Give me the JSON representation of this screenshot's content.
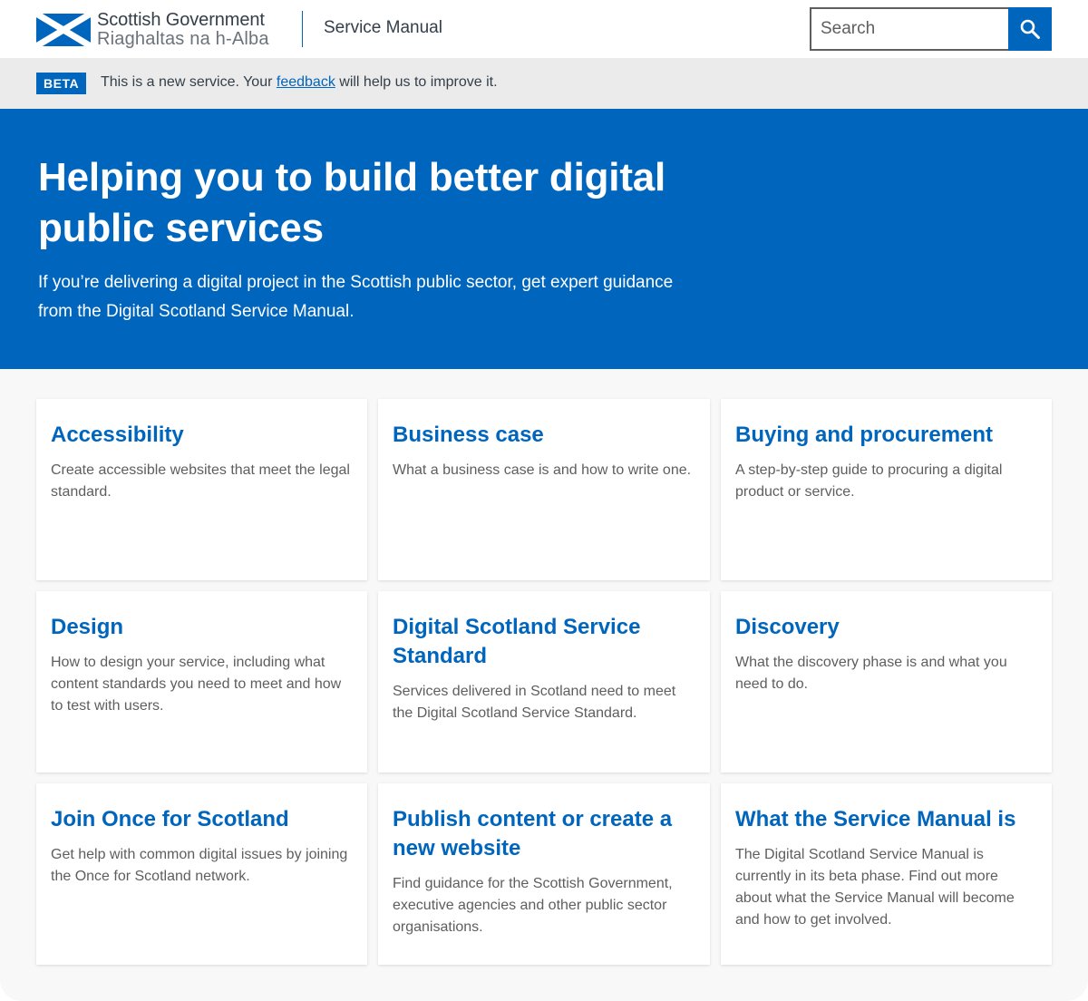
{
  "header": {
    "logo_en": "Scottish Government",
    "logo_gd": "Riaghaltas na h-Alba",
    "site_title": "Service Manual",
    "search_placeholder": "Search"
  },
  "phase_banner": {
    "tag": "BETA",
    "text_before": "This is a new service. Your ",
    "link": "feedback",
    "text_after": " will help us to improve it."
  },
  "hero": {
    "title": "Helping you to build better digital public services",
    "lead": "If you’re delivering a digital project in the Scottish public sector, get expert guidance from the Digital Scotland Service Manual."
  },
  "cards": [
    {
      "title": "Accessibility",
      "description": "Create accessible websites that meet the legal standard."
    },
    {
      "title": "Business case",
      "description": "What a business case is and how to write one."
    },
    {
      "title": "Buying and procurement",
      "description": "A step-by-step guide to procuring a digital product or service."
    },
    {
      "title": "Design",
      "description": "How to design your service, including what content standards you need to meet and how to test with users."
    },
    {
      "title": "Digital Scotland Service Standard",
      "description": "Services delivered in Scotland need to meet the Digital Scotland Service Standard."
    },
    {
      "title": "Discovery",
      "description": "What the discovery phase is and what you need to do."
    },
    {
      "title": "Join Once for Scotland",
      "description": "Get help with common digital issues by joining the Once for Scotland network."
    },
    {
      "title": "Publish content or create a new website",
      "description": "Find guidance for the Scottish Government, executive agencies and other public sector organisations."
    },
    {
      "title": "What the Service Manual is",
      "description": "The Digital Scotland Service Manual is currently in its beta phase. Find out more about what the Service Manual will become and how to get involved."
    }
  ],
  "colors": {
    "brand_blue": "#0065bd",
    "text": "#333e48",
    "muted_text": "#5e5e5e",
    "phase_bg": "#ebebeb",
    "content_bg": "#f8f8f8"
  },
  "icons": {
    "logo": "saltire-flag-icon",
    "search": "search-icon"
  }
}
